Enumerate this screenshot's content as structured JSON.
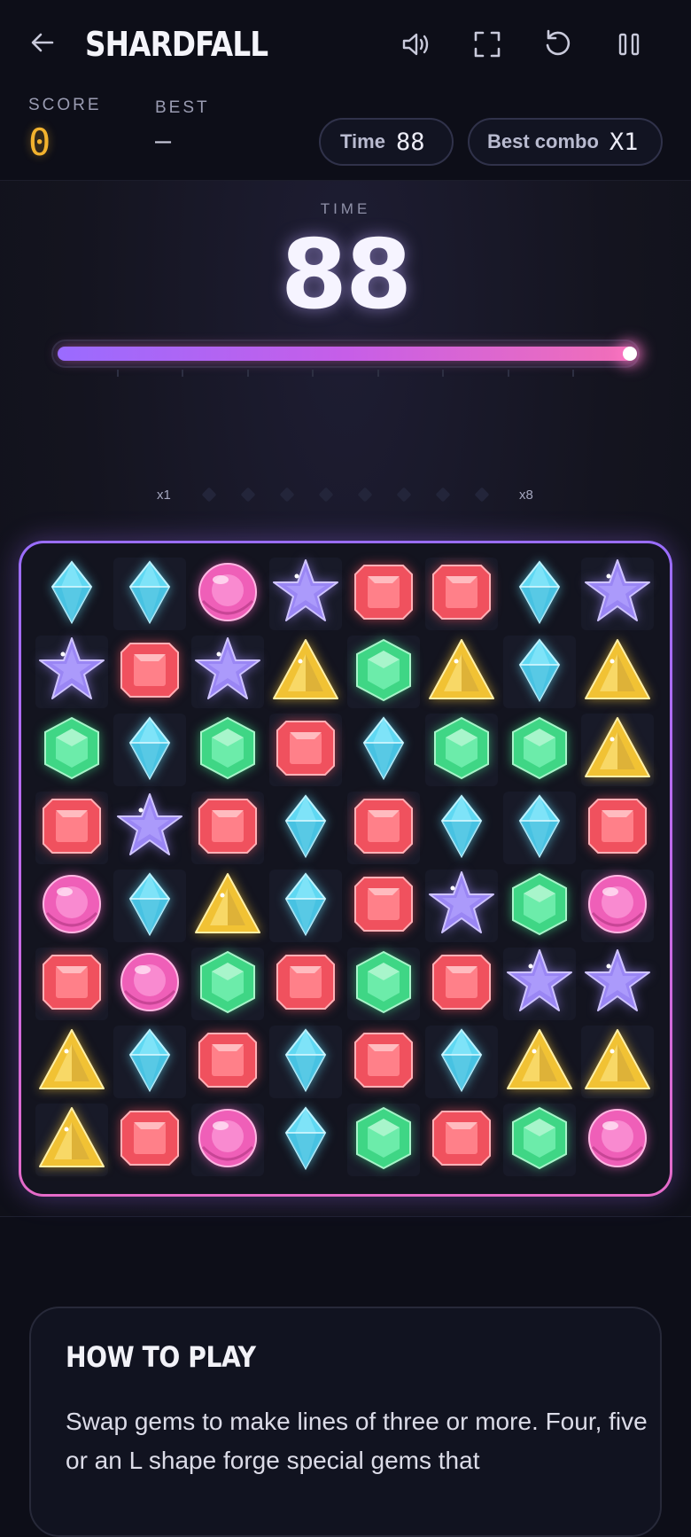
{
  "header": {
    "title": "SHARDFALL",
    "back_icon": "arrow-left-icon",
    "buttons": [
      {
        "name": "sound-button",
        "icon": "speaker-icon"
      },
      {
        "name": "fullscreen-button",
        "icon": "fullscreen-icon"
      },
      {
        "name": "restart-button",
        "icon": "restart-icon"
      },
      {
        "name": "pause-button",
        "icon": "pause-icon"
      }
    ]
  },
  "stats": {
    "score_label": "SCORE",
    "score_value": "0",
    "best_label": "BEST",
    "best_value": "–",
    "time_pill_label": "Time",
    "time_pill_value": "88",
    "combo_pill_label": "Best combo",
    "combo_pill_value": "X1"
  },
  "timer": {
    "label": "TIME",
    "value": "88",
    "progress": 1.0
  },
  "multiplier": {
    "min_label": "x1",
    "max_label": "x8",
    "steps": 8,
    "active": 0
  },
  "colors": {
    "cyan": "#5fd8f2",
    "pink": "#ef5fb8",
    "purple": "#9a86f4",
    "red": "#f0515e",
    "green": "#3fd685",
    "yellow": "#f1c234",
    "accent": "#a46dff"
  },
  "board": {
    "rows": [
      [
        "cyan",
        "cyan",
        "pink",
        "purple",
        "red",
        "red",
        "cyan",
        "purple"
      ],
      [
        "purple",
        "red",
        "purple",
        "yellow",
        "green",
        "yellow",
        "cyan",
        "yellow"
      ],
      [
        "green",
        "cyan",
        "green",
        "red",
        "cyan",
        "green",
        "green",
        "yellow"
      ],
      [
        "red",
        "purple",
        "red",
        "cyan",
        "red",
        "cyan",
        "cyan",
        "red"
      ],
      [
        "pink",
        "cyan",
        "yellow",
        "cyan",
        "red",
        "purple",
        "green",
        "pink"
      ],
      [
        "red",
        "pink",
        "green",
        "red",
        "green",
        "red",
        "purple",
        "purple"
      ],
      [
        "yellow",
        "cyan",
        "red",
        "cyan",
        "red",
        "cyan",
        "yellow",
        "yellow"
      ],
      [
        "yellow",
        "red",
        "pink",
        "cyan",
        "green",
        "red",
        "green",
        "pink"
      ]
    ],
    "gem_shapes": {
      "cyan": "diamond",
      "pink": "orb",
      "purple": "star",
      "red": "square-cut",
      "green": "hexagon",
      "yellow": "triangle"
    }
  },
  "howto": {
    "title": "HOW TO PLAY",
    "body": "Swap gems to make lines of three or more. Four, five or an L shape forge special gems that"
  }
}
